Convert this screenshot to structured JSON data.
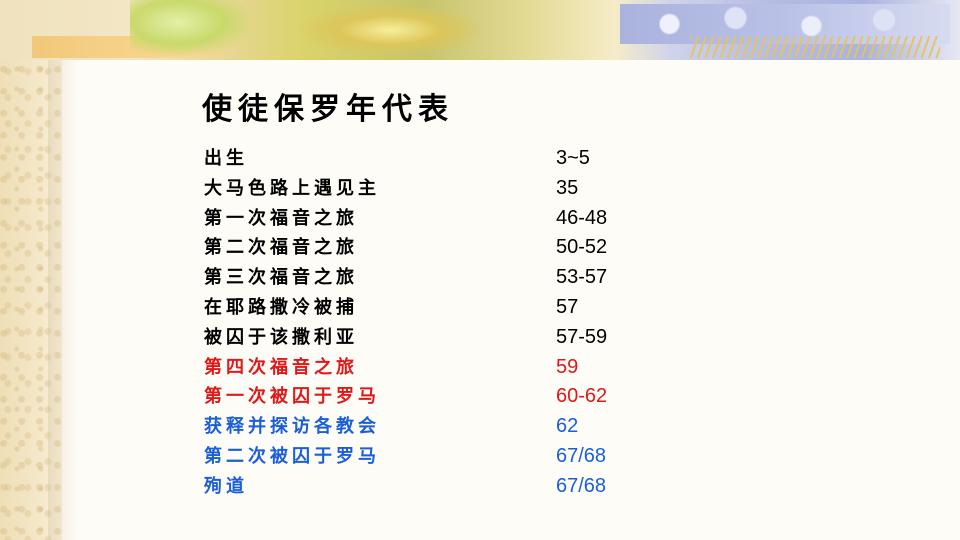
{
  "title": "使徒保罗年代表",
  "colors": {
    "black": "#000000",
    "red": "#e01818",
    "blue": "#1a5fd8"
  },
  "rows": [
    {
      "label": "出生",
      "value": "3~5",
      "color": "#000000"
    },
    {
      "label": "大马色路上遇见主",
      "value": "35",
      "color": "#000000"
    },
    {
      "label": "第一次福音之旅",
      "value": "46-48",
      "color": "#000000"
    },
    {
      "label": "第二次福音之旅",
      "value": "50-52",
      "color": "#000000"
    },
    {
      "label": "第三次福音之旅",
      "value": "53-57",
      "color": "#000000"
    },
    {
      "label": "在耶路撒冷被捕",
      "value": "57",
      "color": "#000000"
    },
    {
      "label": "被囚于该撒利亚",
      "value": "57-59",
      "color": "#000000"
    },
    {
      "label": "第四次福音之旅",
      "value": "59",
      "color": "#e01818"
    },
    {
      "label": "第一次被囚于罗马",
      "value": "60-62",
      "color": "#e01818"
    },
    {
      "label": "获释并探访各教会",
      "value": "62",
      "color": "#1a5fd8"
    },
    {
      "label": "第二次被囚于罗马",
      "value": "67/68",
      "color": "#1a5fd8"
    },
    {
      "label": "殉道",
      "value": "67/68",
      "color": "#1a5fd8"
    }
  ]
}
